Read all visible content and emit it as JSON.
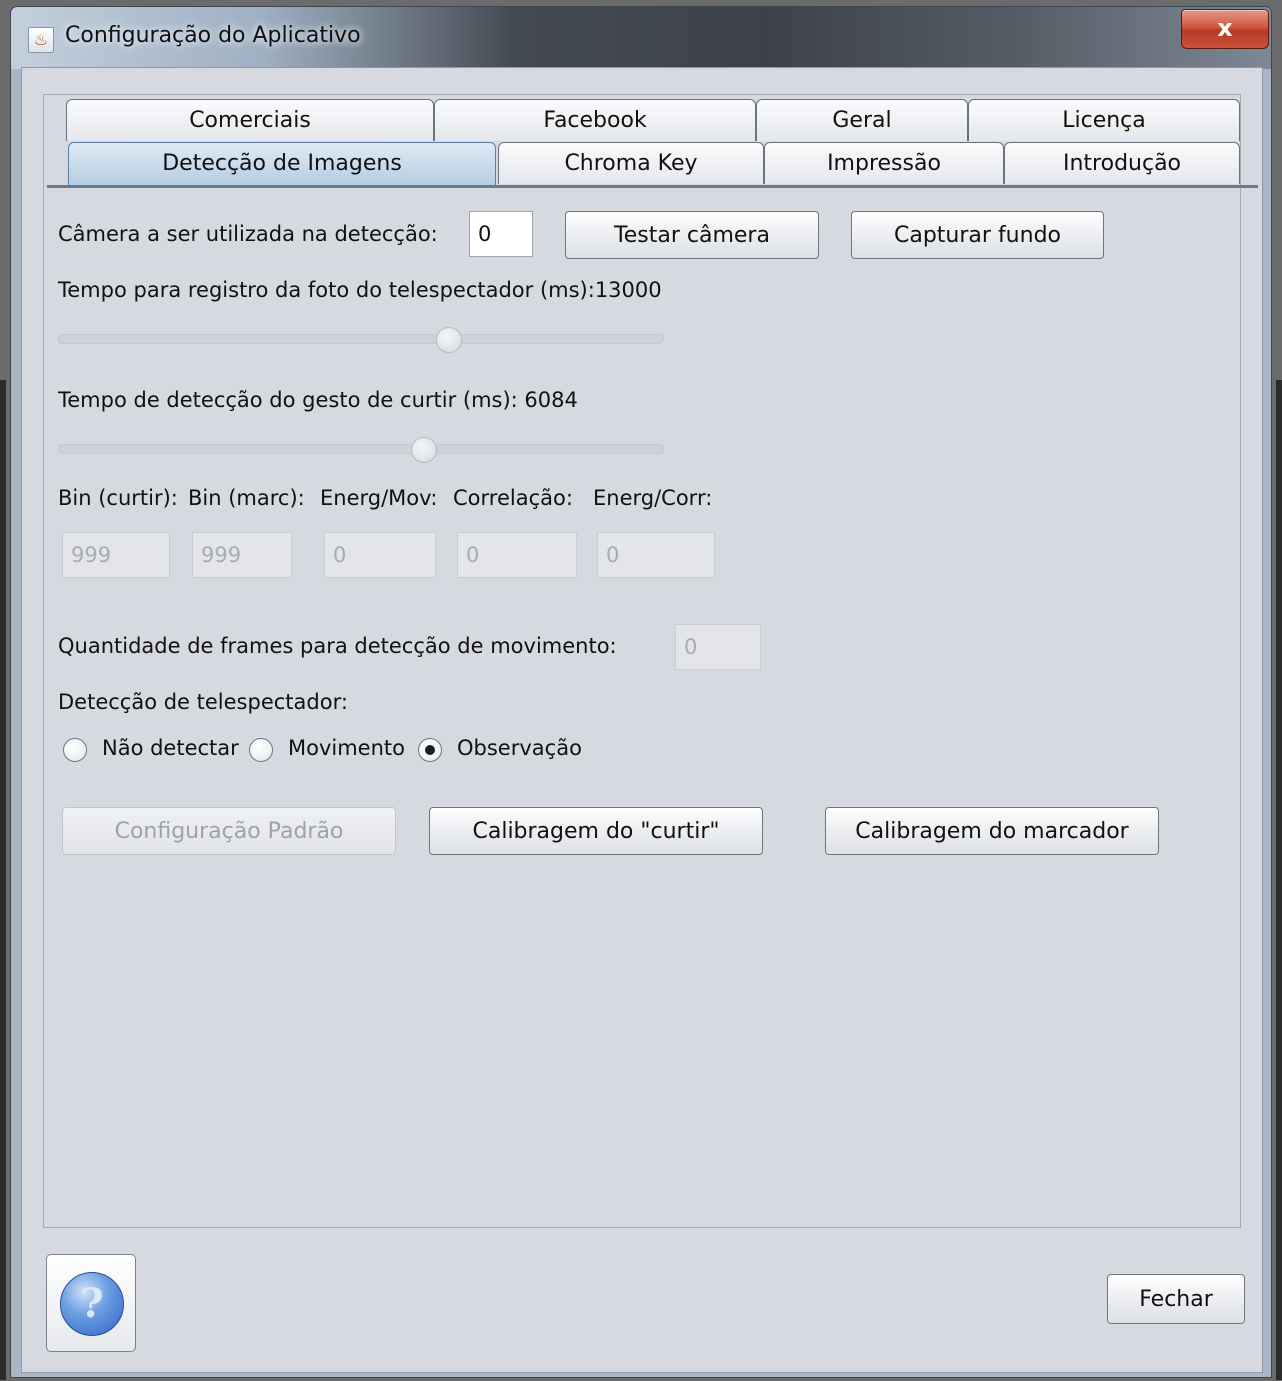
{
  "window": {
    "title": "Configuração do Aplicativo",
    "close_label": "x"
  },
  "tabs": {
    "row1": [
      "Comerciais",
      "Facebook",
      "Geral",
      "Licença"
    ],
    "row2": [
      "Detecção de Imagens",
      "Chroma Key",
      "Impressão",
      "Introdução"
    ],
    "selected": "Detecção de Imagens"
  },
  "camera": {
    "label": "Câmera a ser utilizada na detecção:",
    "value": "0",
    "test_button": "Testar câmera",
    "capture_button": "Capturar fundo"
  },
  "photo_time": {
    "label": "Tempo para registro da foto do telespectador (ms):13000",
    "slider_fraction": 0.645
  },
  "like_time": {
    "label": "Tempo de detecção do gesto de curtir (ms): 6084",
    "slider_fraction": 0.605
  },
  "metrics": [
    {
      "label": "Bin (curtir):",
      "value": "999"
    },
    {
      "label": "Bin (marc):",
      "value": "999"
    },
    {
      "label": "Energ/Mov:",
      "value": "0"
    },
    {
      "label": "Correlação:",
      "value": "0"
    },
    {
      "label": "Energ/Corr:",
      "value": "0"
    }
  ],
  "frames": {
    "label": "Quantidade de frames para detecção de movimento:",
    "value": "0"
  },
  "viewer_detection": {
    "label": "Detecção de telespectador:",
    "options": [
      "Não detectar",
      "Movimento",
      "Observação"
    ],
    "selected": "Observação"
  },
  "actions": {
    "default_config": "Configuração Padrão",
    "calibrate_like": "Calibragem do \"curtir\"",
    "calibrate_marker": "Calibragem do marcador"
  },
  "footer": {
    "help_symbol": "?",
    "close_button": "Fechar"
  }
}
